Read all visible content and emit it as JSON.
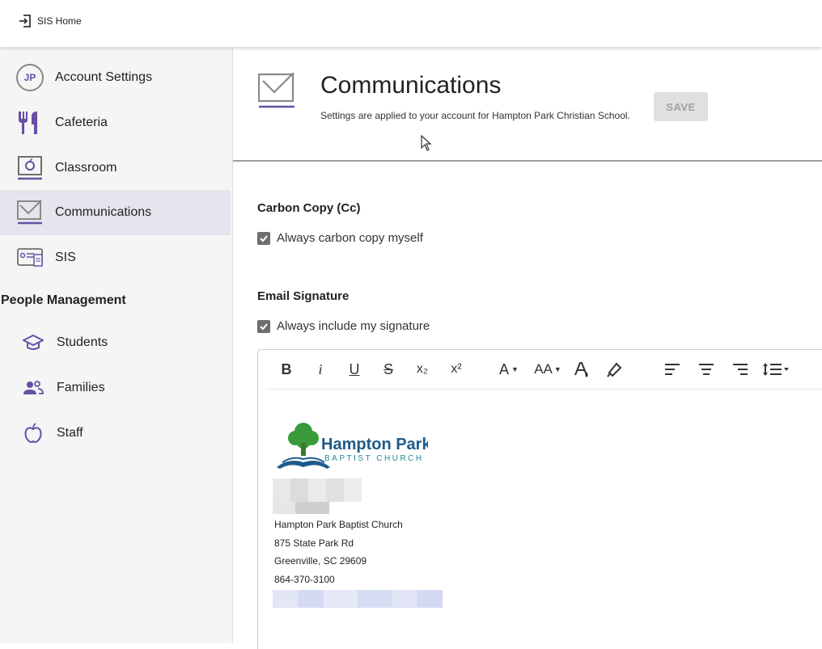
{
  "topbar": {
    "home_label": "SIS Home"
  },
  "sidebar": {
    "items": [
      {
        "label": "Account Settings",
        "avatar": "JP",
        "icon": "avatar-icon"
      },
      {
        "label": "Cafeteria",
        "icon": "fork-knife-icon"
      },
      {
        "label": "Classroom",
        "icon": "classroom-board-icon"
      },
      {
        "label": "Communications",
        "icon": "checkbox-mail-icon",
        "active": true
      },
      {
        "label": "SIS",
        "icon": "id-card-icon"
      }
    ],
    "section_heading": "People Management",
    "sub_items": [
      {
        "label": "Students",
        "icon": "graduation-cap-icon"
      },
      {
        "label": "Families",
        "icon": "people-icon"
      },
      {
        "label": "Staff",
        "icon": "apple-icon"
      }
    ]
  },
  "header": {
    "title": "Communications",
    "subtitle": "Settings are applied to your account for Hampton Park Christian School.",
    "save_label": "SAVE"
  },
  "cc_section": {
    "title": "Carbon Copy (Cc)",
    "checkbox_label": "Always carbon copy myself",
    "checked": true
  },
  "signature_section": {
    "title": "Email Signature",
    "checkbox_label": "Always include my signature",
    "checked": true
  },
  "editor": {
    "toolbar": {
      "bold": "B",
      "italic": "i",
      "underline": "U",
      "strikethrough": "S",
      "subscript": "x₂",
      "superscript": "x²",
      "font_color": "A",
      "font_size": "AA"
    },
    "signature": {
      "logo_text": "Hampton Park",
      "logo_subtext": "BAPTIST CHURCH",
      "lines": [
        "Hampton Park Baptist Church",
        "875 State Park Rd",
        "Greenville, SC 29609",
        "864-370-3100"
      ]
    }
  },
  "colors": {
    "accent": "#6750a4",
    "active_bg": "#e6e5ee",
    "logo_blue": "#1f5a8a",
    "logo_green": "#3a9a3a"
  }
}
